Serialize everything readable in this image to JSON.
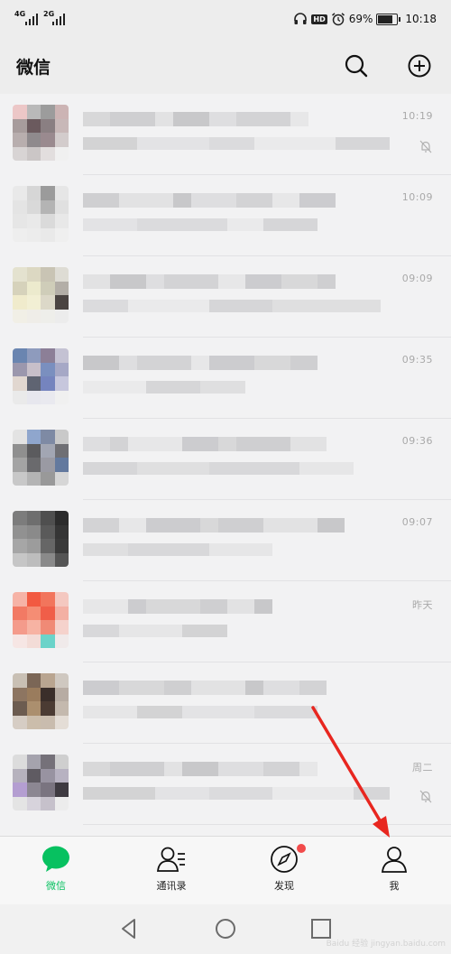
{
  "status_bar": {
    "sim1": "4G",
    "sim2": "2G",
    "battery_percent": "69%",
    "time": "10:18"
  },
  "header": {
    "title": "微信"
  },
  "chats": [
    {
      "time": "10:19",
      "muted": true,
      "avatar": [
        "#ecc7c7",
        "#b9b9b9",
        "#9c9c9c",
        "#ccb4b4",
        "#a79c9c",
        "#6b5a5e",
        "#8a7f82",
        "#c8b8b8",
        "#b8aeae",
        "#8f8a8d",
        "#9a8a8f",
        "#d3cccc",
        "#d8d4d4",
        "#cbc6c6",
        "#e2dede",
        "#f0f0f0"
      ]
    },
    {
      "time": "10:09",
      "muted": false,
      "avatar": [
        "#e9e9e9",
        "#d6d6d6",
        "#9b9b9b",
        "#e6e6e6",
        "#e4e4e4",
        "#d9d9d9",
        "#b4b4b4",
        "#e0e0e0",
        "#e6e6e6",
        "#e9e9e9",
        "#dadada",
        "#e8e8e8",
        "#eeeeee",
        "#ececec",
        "#e9e9e9",
        "#efefef"
      ]
    },
    {
      "time": "09:09",
      "muted": false,
      "avatar": [
        "#e4e2cf",
        "#dcd8c2",
        "#c9c4b4",
        "#dedcd4",
        "#d6d2bb",
        "#eceacd",
        "#cfcdb9",
        "#b3aea7",
        "#f0ebcc",
        "#f2efd4",
        "#dcd8c8",
        "#4b4442",
        "#f1efe6",
        "#efede8",
        "#eeeeea",
        "#ececec"
      ]
    },
    {
      "time": "09:35",
      "muted": false,
      "avatar": [
        "#6a85b0",
        "#8e9bbd",
        "#8c7f97",
        "#c4c2d3",
        "#9b97ad",
        "#c7bfc9",
        "#7a8fbf",
        "#a6a8c6",
        "#e1d7d0",
        "#5f6472",
        "#7584be",
        "#c7c7dd",
        "#eaeaea",
        "#e7e7ee",
        "#e9e9ef",
        "#f0f0f0"
      ]
    },
    {
      "time": "09:36",
      "muted": false,
      "avatar": [
        "#e3e3e3",
        "#8fa6cd",
        "#7e8aa4",
        "#c9c9c9",
        "#8f8f8f",
        "#5b5b5e",
        "#a2a6b3",
        "#6f6f74",
        "#a4a4a4",
        "#6a6a6d",
        "#9a9aa3",
        "#63799e",
        "#c8c8c8",
        "#b4b4b4",
        "#999",
        "#d6d6d6"
      ]
    },
    {
      "time": "09:07",
      "muted": false,
      "avatar": [
        "#7c7c7c",
        "#6e6e6e",
        "#4f4f4f",
        "#2c2c2c",
        "#919191",
        "#8a8a8a",
        "#5a5a5a",
        "#353535",
        "#a6a6a6",
        "#9c9c9c",
        "#666",
        "#3a3a3a",
        "#c6c6c6",
        "#bdbdbd",
        "#8a8a8a",
        "#555"
      ]
    },
    {
      "time": "昨天",
      "muted": false,
      "avatar": [
        "#f6b3a6",
        "#f25a41",
        "#f2755c",
        "#f4c8c0",
        "#f27a64",
        "#f58d74",
        "#f05e49",
        "#f3b0a4",
        "#f49b8b",
        "#f7b3a3",
        "#f08a76",
        "#f5d2cc",
        "#f6e6e4",
        "#f3dcd7",
        "#6bd3c9",
        "#f0eaea"
      ]
    },
    {
      "time": "",
      "muted": false,
      "avatar": [
        "#c9c0b4",
        "#7b6656",
        "#b9a590",
        "#cfc8c0",
        "#8d7561",
        "#9a7c5d",
        "#3a2e2a",
        "#b7aca3",
        "#6c5c50",
        "#ab8f6e",
        "#4b3b33",
        "#c4b9ae",
        "#d6cdc4",
        "#cbbdab",
        "#c9bcae",
        "#e4ddd6"
      ]
    },
    {
      "time": "周二",
      "muted": true,
      "avatar": [
        "#dcdcdc",
        "#a5a3ad",
        "#757179",
        "#cfcfcf",
        "#b6b2bd",
        "#5f5b62",
        "#9893a1",
        "#b7b2c1",
        "#b49ed1",
        "#8c8792",
        "#7a7480",
        "#3e3a41",
        "#e4e4e4",
        "#d7d3dc",
        "#c6c1cb",
        "#ececec"
      ]
    }
  ],
  "tabs": [
    {
      "label": "微信",
      "active": true
    },
    {
      "label": "通讯录",
      "active": false
    },
    {
      "label": "发现",
      "active": false,
      "badge": true
    },
    {
      "label": "我",
      "active": false
    }
  ],
  "watermark": "Baidu 经验 jingyan.baidu.com"
}
